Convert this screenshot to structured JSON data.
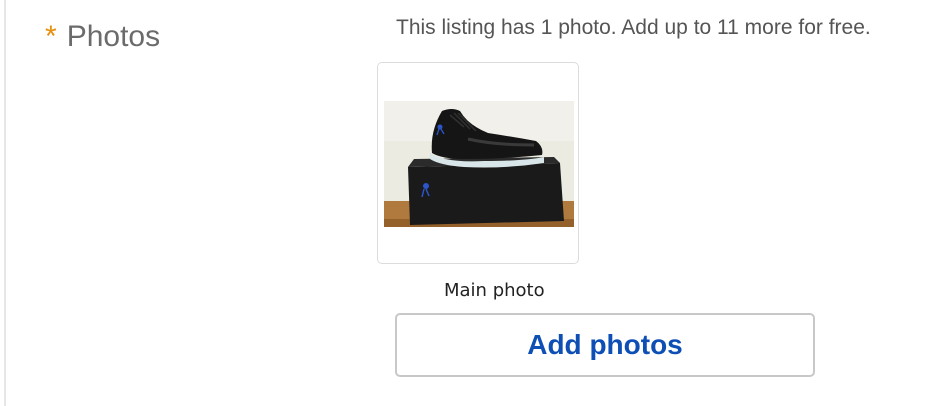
{
  "field": {
    "required_marker": "*",
    "label": "Photos"
  },
  "helper": {
    "text": "This listing has 1 photo. Add up to 11 more for free."
  },
  "photos": [
    {
      "caption": "Main photo",
      "icon": "sneaker-on-shoebox-photo"
    }
  ],
  "actions": {
    "add_photos_label": "Add photos"
  },
  "colors": {
    "required_star": "#e7900f",
    "label": "#6b6b6b",
    "button_text": "#0d4fb5",
    "border": "#c8c8c8"
  }
}
